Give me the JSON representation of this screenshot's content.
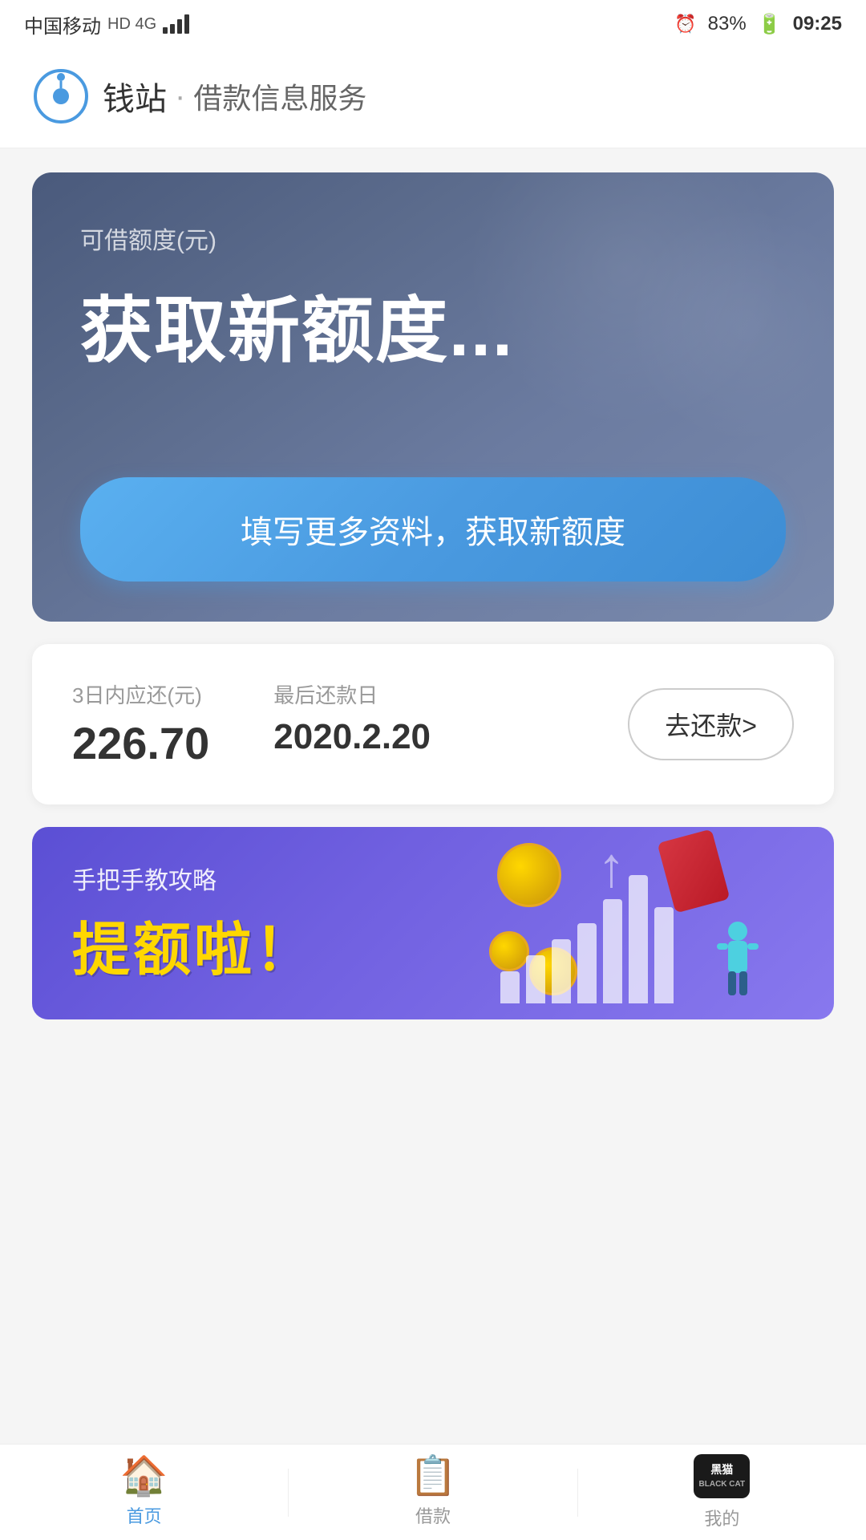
{
  "statusBar": {
    "carrier": "中国移动",
    "networkType": "HD 4G",
    "battery": "83%",
    "time": "09:25"
  },
  "header": {
    "appName": "钱站",
    "separator": "·",
    "service": "借款信息服务",
    "logoAlt": "MONEY Station"
  },
  "creditSection": {
    "label": "可借额度(元)",
    "amount": "获取新额度...",
    "fillBtnLabel": "填写更多资料，获取新额度"
  },
  "repaymentSection": {
    "dueSoonLabel": "3日内应还(元)",
    "dueSoonValue": "226.70",
    "lastRepayLabel": "最后还款日",
    "lastRepayValue": "2020.2.20",
    "repayBtnLabel": "去还款>"
  },
  "bannerSection": {
    "subtitle": "手把手教攻略",
    "title": "提额啦！",
    "chartBars": [
      40,
      60,
      80,
      100,
      130,
      160,
      120
    ],
    "arrowSymbol": "↑"
  },
  "bottomNav": {
    "items": [
      {
        "id": "home",
        "label": "首页",
        "active": true,
        "icon": "🏠"
      },
      {
        "id": "loan",
        "label": "借款",
        "active": false,
        "icon": "📋"
      },
      {
        "id": "me",
        "label": "我的",
        "active": false,
        "icon": "🐱"
      }
    ]
  }
}
